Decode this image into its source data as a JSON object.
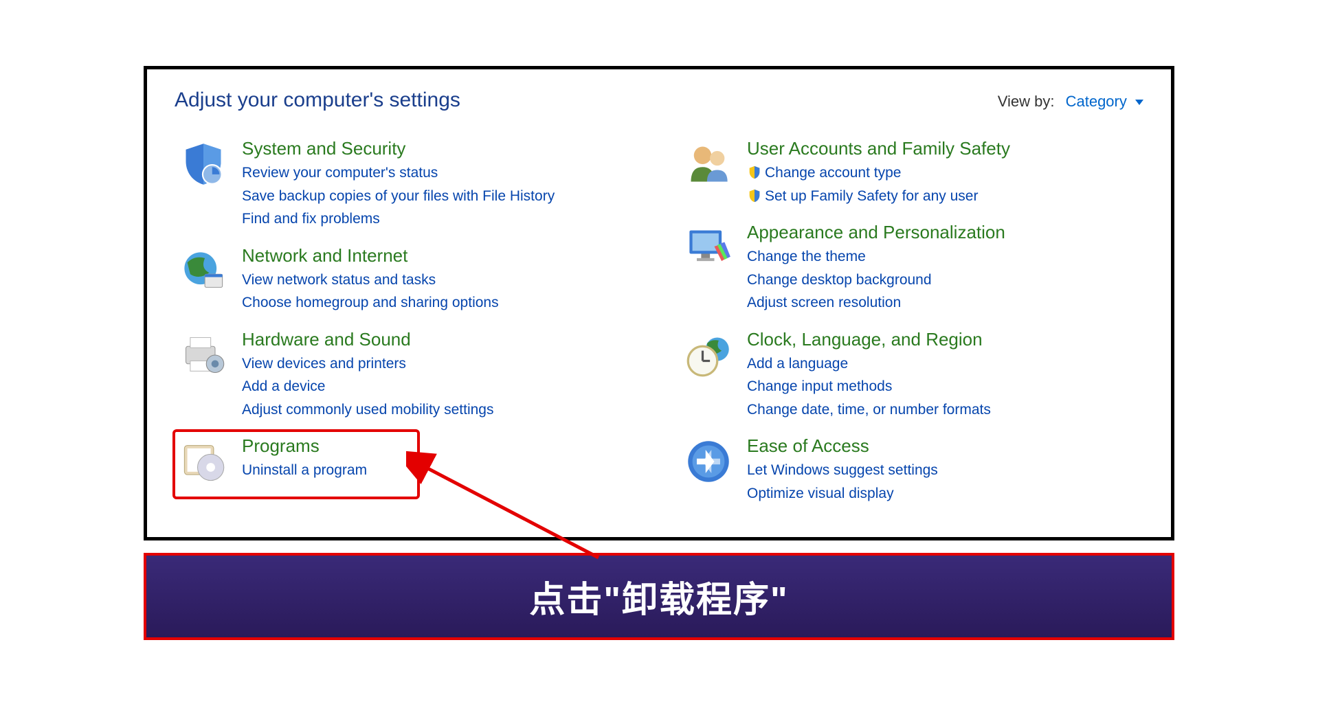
{
  "header": {
    "title": "Adjust your computer's settings",
    "view_by_label": "View by:",
    "view_by_value": "Category"
  },
  "left": [
    {
      "title": "System and Security",
      "links": [
        {
          "text": "Review your computer's status",
          "shield": false
        },
        {
          "text": "Save backup copies of your files with File History",
          "shield": false
        },
        {
          "text": "Find and fix problems",
          "shield": false
        }
      ],
      "icon": "shield"
    },
    {
      "title": "Network and Internet",
      "links": [
        {
          "text": "View network status and tasks",
          "shield": false
        },
        {
          "text": "Choose homegroup and sharing options",
          "shield": false
        }
      ],
      "icon": "globe"
    },
    {
      "title": "Hardware and Sound",
      "links": [
        {
          "text": "View devices and printers",
          "shield": false
        },
        {
          "text": "Add a device",
          "shield": false
        },
        {
          "text": "Adjust commonly used mobility settings",
          "shield": false
        }
      ],
      "icon": "printer"
    },
    {
      "title": "Programs",
      "links": [
        {
          "text": "Uninstall a program",
          "shield": false
        }
      ],
      "icon": "programs"
    }
  ],
  "right": [
    {
      "title": "User Accounts and Family Safety",
      "links": [
        {
          "text": "Change account type",
          "shield": true
        },
        {
          "text": "Set up Family Safety for any user",
          "shield": true
        }
      ],
      "icon": "users"
    },
    {
      "title": "Appearance and Personalization",
      "links": [
        {
          "text": "Change the theme",
          "shield": false
        },
        {
          "text": "Change desktop background",
          "shield": false
        },
        {
          "text": "Adjust screen resolution",
          "shield": false
        }
      ],
      "icon": "monitor"
    },
    {
      "title": "Clock, Language, and Region",
      "links": [
        {
          "text": "Add a language",
          "shield": false
        },
        {
          "text": "Change input methods",
          "shield": false
        },
        {
          "text": "Change date, time, or number formats",
          "shield": false
        }
      ],
      "icon": "clock"
    },
    {
      "title": "Ease of Access",
      "links": [
        {
          "text": "Let Windows suggest settings",
          "shield": false
        },
        {
          "text": "Optimize visual display",
          "shield": false
        }
      ],
      "icon": "ease"
    }
  ],
  "annotation": {
    "instruction": "点击\"卸载程序\""
  }
}
